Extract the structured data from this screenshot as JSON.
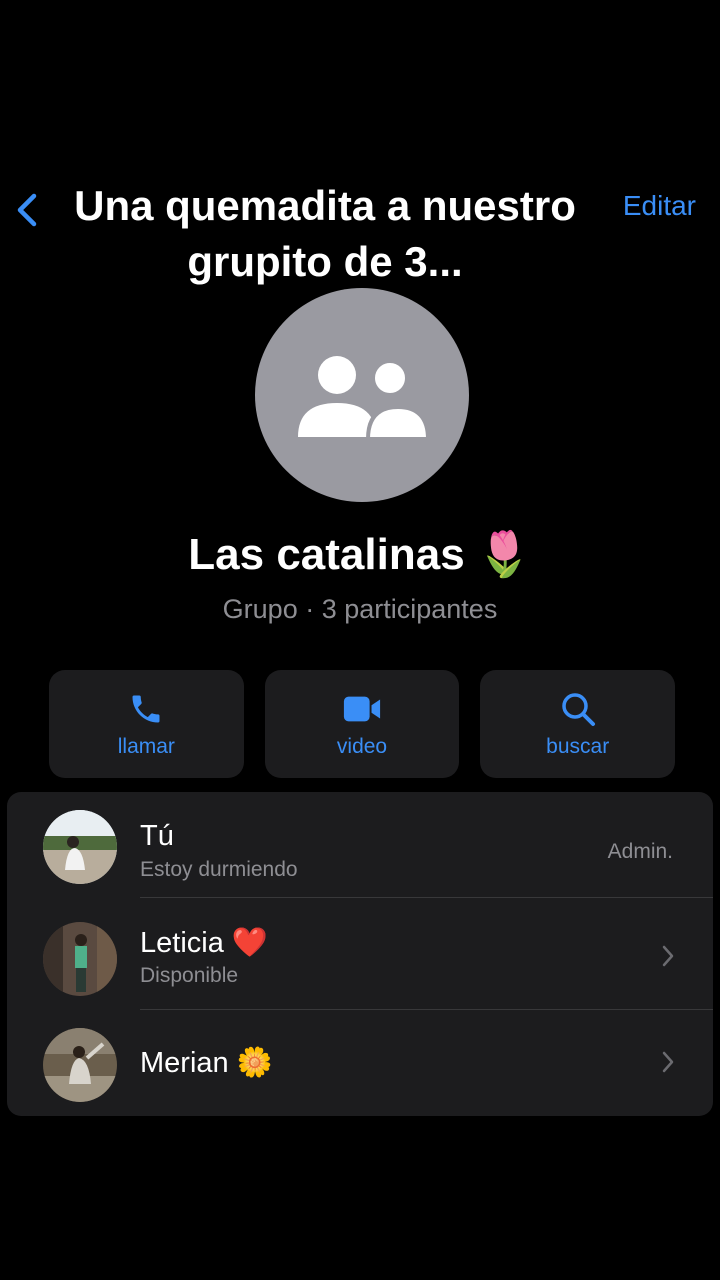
{
  "header": {
    "caption": "Una quemadita a nuestro grupito de 3...",
    "edit_label": "Editar"
  },
  "group": {
    "name": "Las catalinas 🌷",
    "subtitle": "Grupo · 3 participantes"
  },
  "actions": [
    {
      "label": "llamar",
      "icon": "phone-icon"
    },
    {
      "label": "video",
      "icon": "video-camera-icon"
    },
    {
      "label": "buscar",
      "icon": "search-icon"
    }
  ],
  "participants": [
    {
      "name": "Tú",
      "status": "Estoy durmiendo",
      "role": "Admin."
    },
    {
      "name": "Leticia ❤️",
      "status": "Disponible"
    },
    {
      "name": "Merian 🌼"
    }
  ],
  "colors": {
    "accent": "#3a8ef6",
    "background": "#000000",
    "card": "#1c1c1e",
    "secondary_text": "#8e8e93",
    "avatar_placeholder": "#9a9aa1"
  }
}
